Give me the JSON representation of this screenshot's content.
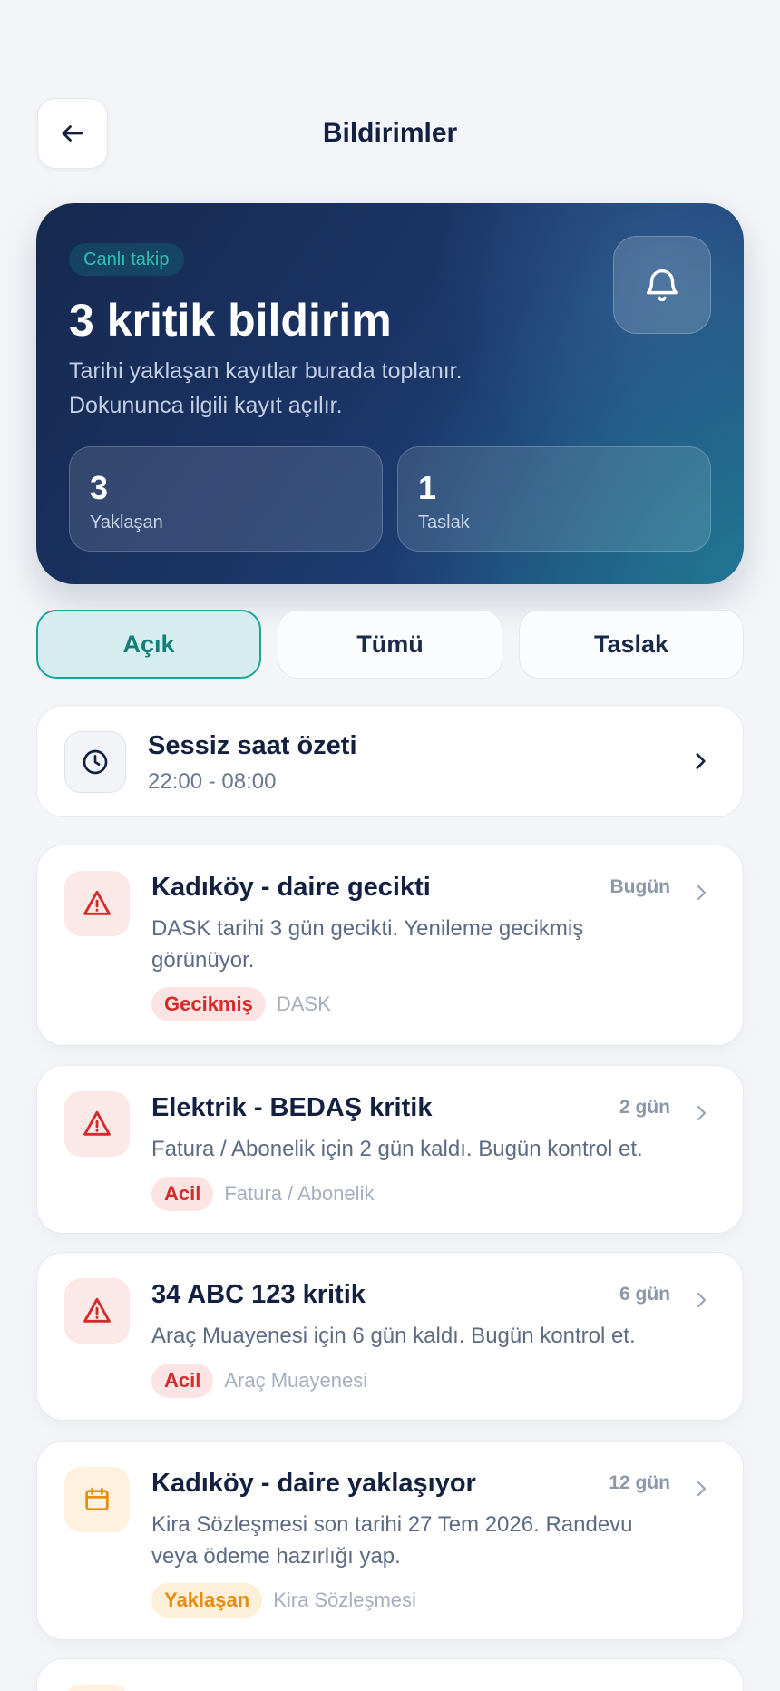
{
  "header": {
    "title": "Bildirimler"
  },
  "hero": {
    "chip": "Canlı takip",
    "title": "3 kritik bildirim",
    "description": "Tarihi yaklaşan kayıtlar burada toplanır. Dokununca ilgili kayıt açılır.",
    "stats": [
      {
        "value": "3",
        "label": "Yaklaşan"
      },
      {
        "value": "1",
        "label": "Taslak"
      }
    ]
  },
  "tabs": [
    {
      "label": "Açık",
      "active": true
    },
    {
      "label": "Tümü",
      "active": false
    },
    {
      "label": "Taslak",
      "active": false
    }
  ],
  "quiet_hours": {
    "title": "Sessiz saat özeti",
    "range": "22:00 - 08:00"
  },
  "notifications": [
    {
      "title": "Kadıköy - daire gecikti",
      "time": "Bugün",
      "description": "DASK tarihi 3 gün gecikti. Yenileme gecikmiş görünüyor.",
      "tag": "Gecikmiş",
      "category": "DASK",
      "icon": "warning-triangle-icon",
      "tone": "#d42a2a"
    },
    {
      "title": "Elektrik - BEDAŞ kritik",
      "time": "2 gün",
      "description": "Fatura / Abonelik için 2 gün kaldı. Bugün kontrol et.",
      "tag": "Acil",
      "category": "Fatura / Abonelik",
      "icon": "warning-triangle-icon",
      "tone": "#d42a2a"
    },
    {
      "title": "34 ABC 123 kritik",
      "time": "6 gün",
      "description": "Araç Muayenesi için 6 gün kaldı. Bugün kontrol et.",
      "tag": "Acil",
      "category": "Araç Muayenesi",
      "icon": "warning-triangle-icon",
      "tone": "#d42a2a"
    },
    {
      "title": "Kadıköy - daire yaklaşıyor",
      "time": "12 gün",
      "description": "Kira Sözleşmesi son tarihi 27 Tem 2026. Randevu veya ödeme hazırlığı yap.",
      "tag": "Yaklaşan",
      "category": "Kira Sözleşmesi",
      "icon": "calendar-icon",
      "tone": "#e48d10"
    }
  ],
  "colors": {
    "accent": "#1aa79a",
    "hero_bg": "#1b3466",
    "danger": "#d42a2a",
    "warning": "#e48d10"
  }
}
